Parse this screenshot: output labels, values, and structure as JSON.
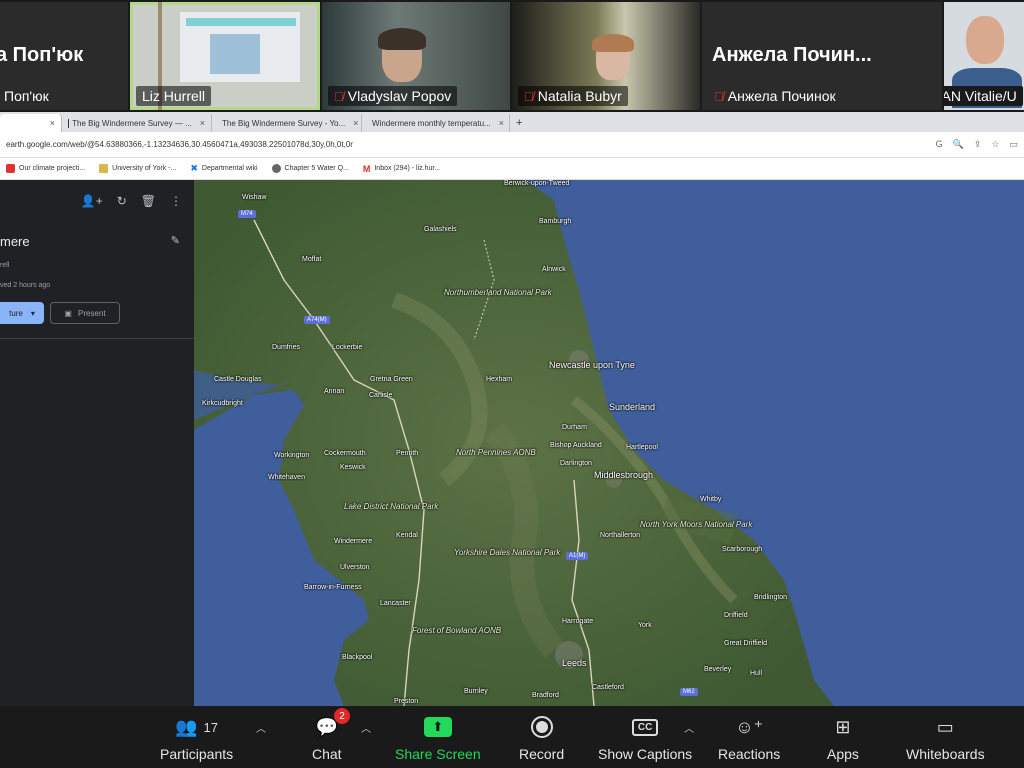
{
  "participants": [
    {
      "big_name": "а Поп'юк",
      "name": "Поп'юк",
      "muted": false,
      "video": false
    },
    {
      "name": "Liz Hurrell",
      "muted": false,
      "video": true,
      "active": true
    },
    {
      "name": "Vladyslav Popov",
      "muted": true,
      "video": true
    },
    {
      "name": "Natalia Bubyr",
      "muted": true,
      "video": true
    },
    {
      "big_name": "Анжела Починок",
      "big_name_display": "Анжела Почин...",
      "name": "Анжела Починок",
      "muted": true,
      "video": false
    },
    {
      "name": "DILAN Vitalie/U",
      "muted": true,
      "video": true
    }
  ],
  "browser": {
    "tabs": [
      {
        "label": "",
        "close": "×"
      },
      {
        "label": "The Big Windermere Survey — ...",
        "close": "×"
      },
      {
        "label": "The Big Windermere Survey - Yo...",
        "close": "×"
      },
      {
        "label": "Windermere monthly temperatu...",
        "close": "×"
      }
    ],
    "new_tab": "+",
    "url": "earth.google.com/web/@54.63880366,-1.13234636,30.4560471a,493038.22501078d,30y,0h,0t,0r",
    "bookmarks": [
      "Our climate projecti...",
      "University of York -...",
      "Departmental wiki",
      "Chapter 5 Water Q...",
      "Inbox (294) - liz.hur..."
    ]
  },
  "side_panel": {
    "title": "mere",
    "owner": "rell",
    "saved": "ved 2 hours ago",
    "new_button": "ture",
    "present_button": "Present"
  },
  "map": {
    "places": [
      "Berwick-upon-Tweed",
      "Wishaw",
      "Galashiels",
      "Bamburgh",
      "Moffat",
      "Alnwick",
      "Northumberland National Park",
      "Dumfries",
      "Lockerbie",
      "Newcastle upon Tyne",
      "Castle Douglas",
      "Annan",
      "Gretna Green",
      "Hexham",
      "Carlisle",
      "Sunderland",
      "Kirkcudbright",
      "Durham",
      "Bishop Auckland",
      "Hartlepool",
      "Workington",
      "Cockermouth",
      "Penrith",
      "Keswick",
      "Whitehaven",
      "North Pennines AONB",
      "Middlesbrough",
      "Darlington",
      "Whitby",
      "Lake District National Park",
      "Northallerton",
      "North York Moors National Park",
      "Windermere",
      "Kendal",
      "Scarborough",
      "Ulverston",
      "Yorkshire Dales National Park",
      "Barrow-in-Furness",
      "Bridlington",
      "Driffield",
      "Lancaster",
      "Harrogate",
      "Forest of Bowland AONB",
      "York",
      "Blackpool",
      "Great Driffield",
      "Leeds",
      "Beverley",
      "Hull",
      "Burnley",
      "Bradford",
      "Castleford",
      "Preston"
    ],
    "roads": [
      "M74",
      "A74(M)",
      "A1(M)",
      "M62"
    ]
  },
  "toolbar": {
    "participants_label": "Participants",
    "participants_count": "17",
    "chat_label": "Chat",
    "chat_badge": "2",
    "share_label": "Share Screen",
    "record_label": "Record",
    "captions_label": "Show Captions",
    "captions_icon_text": "CC",
    "reactions_label": "Reactions",
    "apps_label": "Apps",
    "whiteboards_label": "Whiteboards"
  },
  "colors": {
    "share_green": "#23d959",
    "badge_red": "#e02828",
    "sea": "#3f5e9b",
    "land": "#4f6b3c"
  }
}
